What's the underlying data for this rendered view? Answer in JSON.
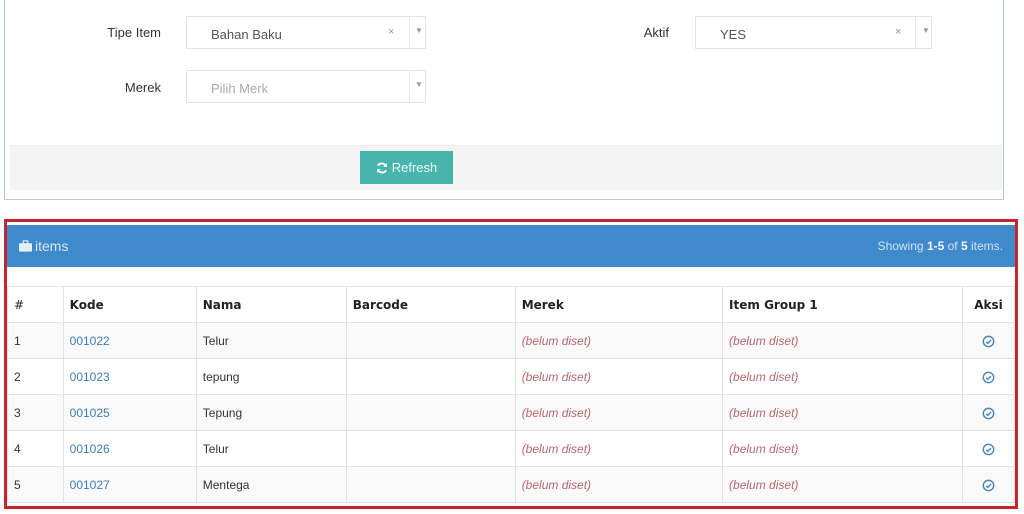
{
  "filters": {
    "tipe_item": {
      "label": "Tipe Item",
      "value": "Bahan Baku"
    },
    "aktif": {
      "label": "Aktif",
      "value": "YES"
    },
    "merek": {
      "label": "Merek",
      "placeholder": "Pilih Merk"
    },
    "clear_glyph": "×",
    "arrow_glyph": "▼",
    "refresh_label": "Refresh"
  },
  "panel": {
    "title": "items",
    "summary": {
      "prefix": "Showing ",
      "range": "1-5",
      "mid": " of ",
      "total": "5",
      "suffix": " items."
    }
  },
  "table": {
    "headers": [
      "#",
      "Kode",
      "Nama",
      "Barcode",
      "Merek",
      "Item Group 1",
      "Aksi"
    ],
    "rows": [
      {
        "num": "1",
        "kode": "001022",
        "nama": "Telur",
        "barcode": "",
        "merek": "(belum diset)",
        "group": "(belum diset)"
      },
      {
        "num": "2",
        "kode": "001023",
        "nama": "tepung",
        "barcode": "",
        "merek": "(belum diset)",
        "group": "(belum diset)"
      },
      {
        "num": "3",
        "kode": "001025",
        "nama": "Tepung",
        "barcode": "",
        "merek": "(belum diset)",
        "group": "(belum diset)"
      },
      {
        "num": "4",
        "kode": "001026",
        "nama": "Telur",
        "barcode": "",
        "merek": "(belum diset)",
        "group": "(belum diset)"
      },
      {
        "num": "5",
        "kode": "001027",
        "nama": "Mentega",
        "barcode": "",
        "merek": "(belum diset)",
        "group": "(belum diset)"
      }
    ]
  },
  "colors": {
    "panel_header": "#3f8acb",
    "refresh_button": "#48b5ad",
    "highlight_border": "#c0282d",
    "link": "#3c7fb1",
    "not_set": "#b5686e"
  }
}
